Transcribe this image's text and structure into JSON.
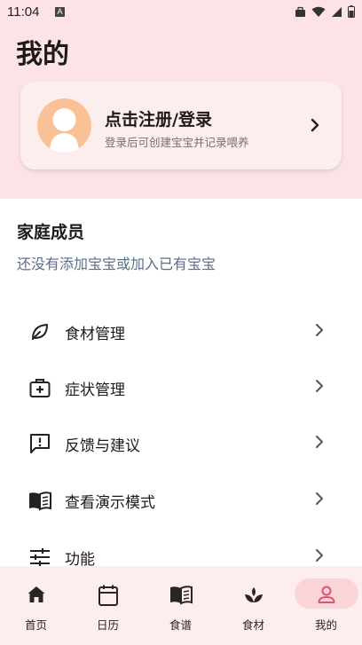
{
  "status_bar": {
    "time": "11:04",
    "notification_letter": "A"
  },
  "page": {
    "title": "我的"
  },
  "login_card": {
    "title": "点击注册/登录",
    "subtitle": "登录后可创建宝宝并记录喂养"
  },
  "family": {
    "title": "家庭成员",
    "subtitle": "还没有添加宝宝或加入已有宝宝"
  },
  "menu": {
    "items": [
      {
        "label": "食材管理",
        "icon": "leaf-icon"
      },
      {
        "label": "症状管理",
        "icon": "medical-kit-icon"
      },
      {
        "label": "反馈与建议",
        "icon": "feedback-icon"
      },
      {
        "label": "查看演示模式",
        "icon": "book-icon"
      },
      {
        "label": "功能",
        "icon": "sliders-icon"
      }
    ]
  },
  "bottom_nav": {
    "items": [
      {
        "label": "首页",
        "icon": "home-icon",
        "active": false
      },
      {
        "label": "日历",
        "icon": "calendar-icon",
        "active": false
      },
      {
        "label": "食谱",
        "icon": "recipe-book-icon",
        "active": false
      },
      {
        "label": "食材",
        "icon": "sprout-icon",
        "active": false
      },
      {
        "label": "我的",
        "icon": "person-icon",
        "active": true
      }
    ]
  },
  "colors": {
    "header_bg": "#fde3e5",
    "card_bg": "#fdeeee",
    "accent": "#e0556a",
    "subtitle_blue": "#5a6e8a"
  }
}
